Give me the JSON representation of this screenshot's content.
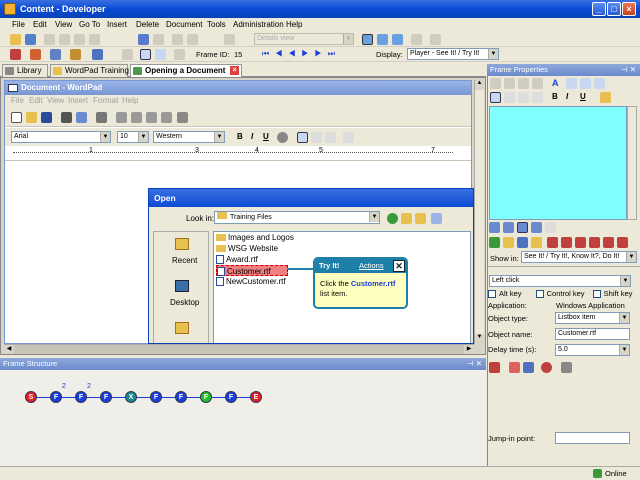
{
  "window": {
    "title": "Content - Developer"
  },
  "menu": [
    "File",
    "Edit",
    "View",
    "Go To",
    "Insert",
    "Delete",
    "Document",
    "Tools",
    "Administration",
    "Help"
  ],
  "toolbar": {
    "view_select": "Details view",
    "frame_id_label": "Frame ID:",
    "frame_id_value": "15",
    "display_label": "Display:",
    "display_value": "Player - See It! / Try It!"
  },
  "tabs": [
    {
      "label": "Library",
      "active": false
    },
    {
      "label": "WordPad Training",
      "active": false
    },
    {
      "label": "Opening a Document",
      "active": true
    }
  ],
  "wordpad": {
    "title": "Document - WordPad",
    "menu": [
      "File",
      "Edit",
      "View",
      "Insert",
      "Format",
      "Help"
    ],
    "font": "Arial",
    "size": "10",
    "script": "Western"
  },
  "open_dialog": {
    "title": "Open",
    "look_in_label": "Look in:",
    "look_in_value": "Training Files",
    "places": [
      "Recent",
      "Desktop"
    ],
    "files": [
      "Images and Logos",
      "WSG Website",
      "Award.rtf",
      "Customer.rtf",
      "NewCustomer.rtf"
    ]
  },
  "callout": {
    "title": "Try It!",
    "actions": "Actions",
    "text_pre": "Click the",
    "text_bold": "Customer.rtf",
    "text_post": "list item."
  },
  "frame_structure": {
    "title": "Frame Structure",
    "nodes": [
      {
        "label": "S",
        "color": "#e02020",
        "badge": ""
      },
      {
        "label": "F",
        "color": "#1a3fd8",
        "badge": "2"
      },
      {
        "label": "F",
        "color": "#1a3fd8",
        "badge": "2"
      },
      {
        "label": "F",
        "color": "#1a3fd8",
        "badge": ""
      },
      {
        "label": "X",
        "color": "#1a8a8a",
        "badge": ""
      },
      {
        "label": "F",
        "color": "#1a3fd8",
        "badge": ""
      },
      {
        "label": "F",
        "color": "#1a3fd8",
        "badge": ""
      },
      {
        "label": "F",
        "color": "#22c022",
        "badge": ""
      },
      {
        "label": "F",
        "color": "#1a3fd8",
        "badge": ""
      },
      {
        "label": "E",
        "color": "#e02020",
        "badge": ""
      }
    ]
  },
  "frame_properties": {
    "title": "Frame Properties",
    "show_in_label": "Show in:",
    "show_in_value": "See It! / Try It!, Know It?, Do It!",
    "action_value": "Left click",
    "alt_key": "Alt key",
    "control_key": "Control key",
    "shift_key": "Shift key",
    "application_label": "Application:",
    "application_value": "Windows Application",
    "object_type_label": "Object type:",
    "object_type_value": "Listbox item",
    "object_name_label": "Object name:",
    "object_name_value": "Customer.rtf",
    "delay_label": "Delay time (s):",
    "delay_value": "5.0",
    "jump_in_label": "Jump-in point:",
    "jump_in_value": ""
  },
  "status": {
    "online": "Online"
  },
  "colors": {
    "accent": "#0a4bd4",
    "preview": "#80ffff",
    "callout": "#1e7fa8"
  }
}
